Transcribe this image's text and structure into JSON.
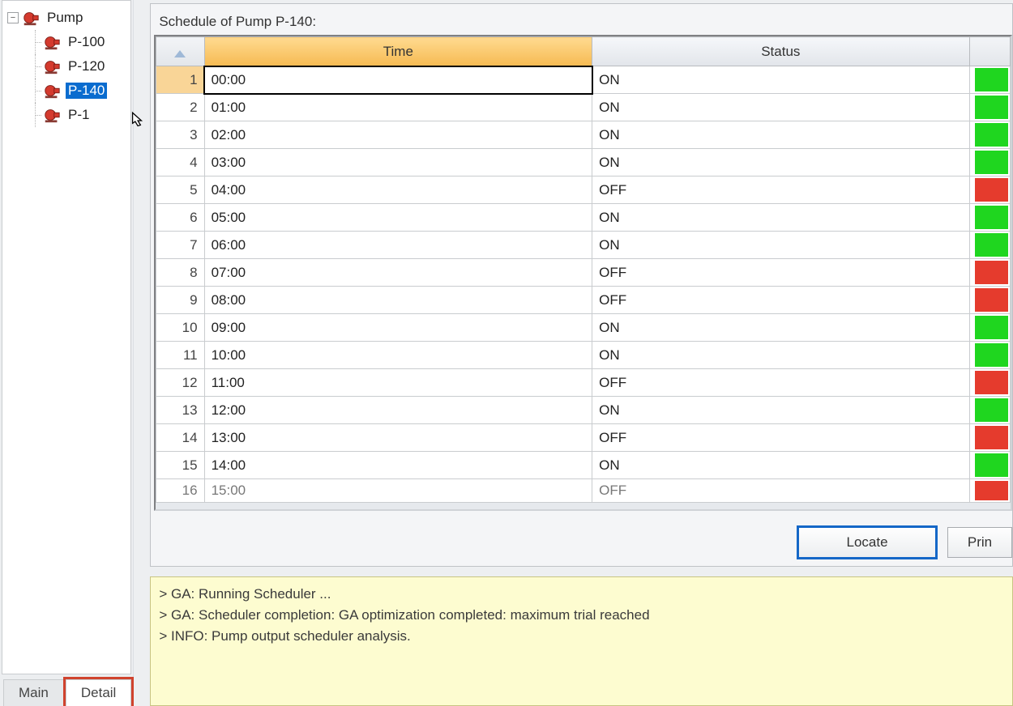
{
  "tree": {
    "root_label": "Pump",
    "children": [
      {
        "label": "P-100"
      },
      {
        "label": "P-120"
      },
      {
        "label": "P-140",
        "selected": true
      },
      {
        "label": "P-1"
      }
    ]
  },
  "tabs": {
    "main": "Main",
    "detail": "Detail",
    "active": "Detail"
  },
  "schedule": {
    "title": "Schedule of Pump P-140:",
    "columns": {
      "time": "Time",
      "status": "Status"
    },
    "rows": [
      {
        "n": "1",
        "time": "00:00",
        "status": "ON"
      },
      {
        "n": "2",
        "time": "01:00",
        "status": "ON"
      },
      {
        "n": "3",
        "time": "02:00",
        "status": "ON"
      },
      {
        "n": "4",
        "time": "03:00",
        "status": "ON"
      },
      {
        "n": "5",
        "time": "04:00",
        "status": "OFF"
      },
      {
        "n": "6",
        "time": "05:00",
        "status": "ON"
      },
      {
        "n": "7",
        "time": "06:00",
        "status": "ON"
      },
      {
        "n": "8",
        "time": "07:00",
        "status": "OFF"
      },
      {
        "n": "9",
        "time": "08:00",
        "status": "OFF"
      },
      {
        "n": "10",
        "time": "09:00",
        "status": "ON"
      },
      {
        "n": "11",
        "time": "10:00",
        "status": "ON"
      },
      {
        "n": "12",
        "time": "11:00",
        "status": "OFF"
      },
      {
        "n": "13",
        "time": "12:00",
        "status": "ON"
      },
      {
        "n": "14",
        "time": "13:00",
        "status": "OFF"
      },
      {
        "n": "15",
        "time": "14:00",
        "status": "ON"
      },
      {
        "n": "16",
        "time": "15:00",
        "status": "OFF"
      }
    ],
    "selected_row": 0
  },
  "buttons": {
    "locate": "Locate",
    "print": "Prin"
  },
  "log": [
    "> GA: Running Scheduler ...",
    "> GA: Scheduler completion: GA optimization completed: maximum trial reached",
    "> INFO: Pump output scheduler analysis."
  ],
  "colors": {
    "on": "#1fd61f",
    "off": "#e53b2d",
    "accent": "#0a6ccf"
  }
}
